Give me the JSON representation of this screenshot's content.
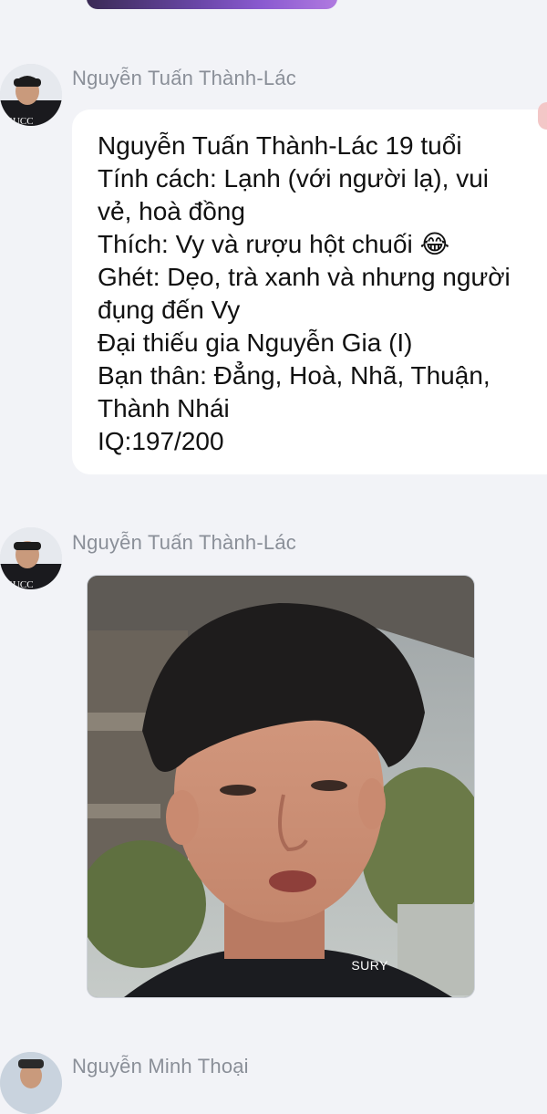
{
  "messages": [
    {
      "sender": "Nguyễn Tuấn Thành-Lác",
      "lines": [
        "Nguyễn Tuấn Thành-Lác 19 tuổi",
        "Tính cách: Lạnh (với người lạ), vui",
        "vẻ, hoà đồng",
        "Thích: Vy và rượu hột chuối 😂",
        "Ghét: Dẹo, trà xanh và nhưng người",
        "đụng đến Vy",
        "Đại thiếu gia Nguyễn Gia (I)",
        "Bạn thân: Đẳng, Hoà, Nhã, Thuận,",
        "Thành Nhái",
        "IQ:197/200"
      ],
      "avatar_text": "GUCC"
    },
    {
      "sender": "Nguyễn Tuấn Thành-Lác",
      "photo_watermark": "SURY",
      "avatar_text": "GUCC"
    },
    {
      "sender": "Nguyễn Minh Thoại"
    }
  ]
}
